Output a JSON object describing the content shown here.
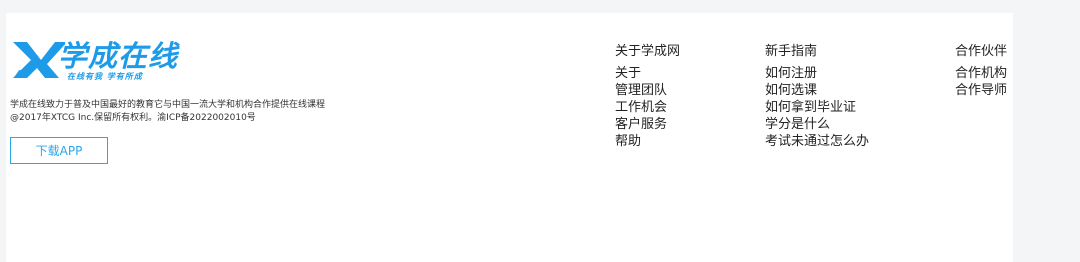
{
  "brand": {
    "logo_title": "学成在线",
    "slogan": "在线有我  学有所成",
    "description": "学成在线致力于普及中国最好的教育它与中国一流大学和机构合作提供在线课程",
    "copyright": "@2017年XTCG Inc.保留所有权利。渝ICP备2022002010号",
    "download_label": "下载APP",
    "accent_color": "#1e9be8",
    "logo_icon": "x-logo-icon"
  },
  "columns": {
    "about": {
      "title": "关于学成网",
      "items": [
        "关于",
        "管理团队",
        "工作机会",
        "客户服务",
        "帮助"
      ]
    },
    "guide": {
      "title": "新手指南",
      "items": [
        "如何注册",
        "如何选课",
        "如何拿到毕业证",
        "学分是什么",
        "考试未通过怎么办"
      ]
    },
    "partner": {
      "title": "合作伙伴",
      "items": [
        "合作机构",
        "合作导师"
      ]
    }
  }
}
